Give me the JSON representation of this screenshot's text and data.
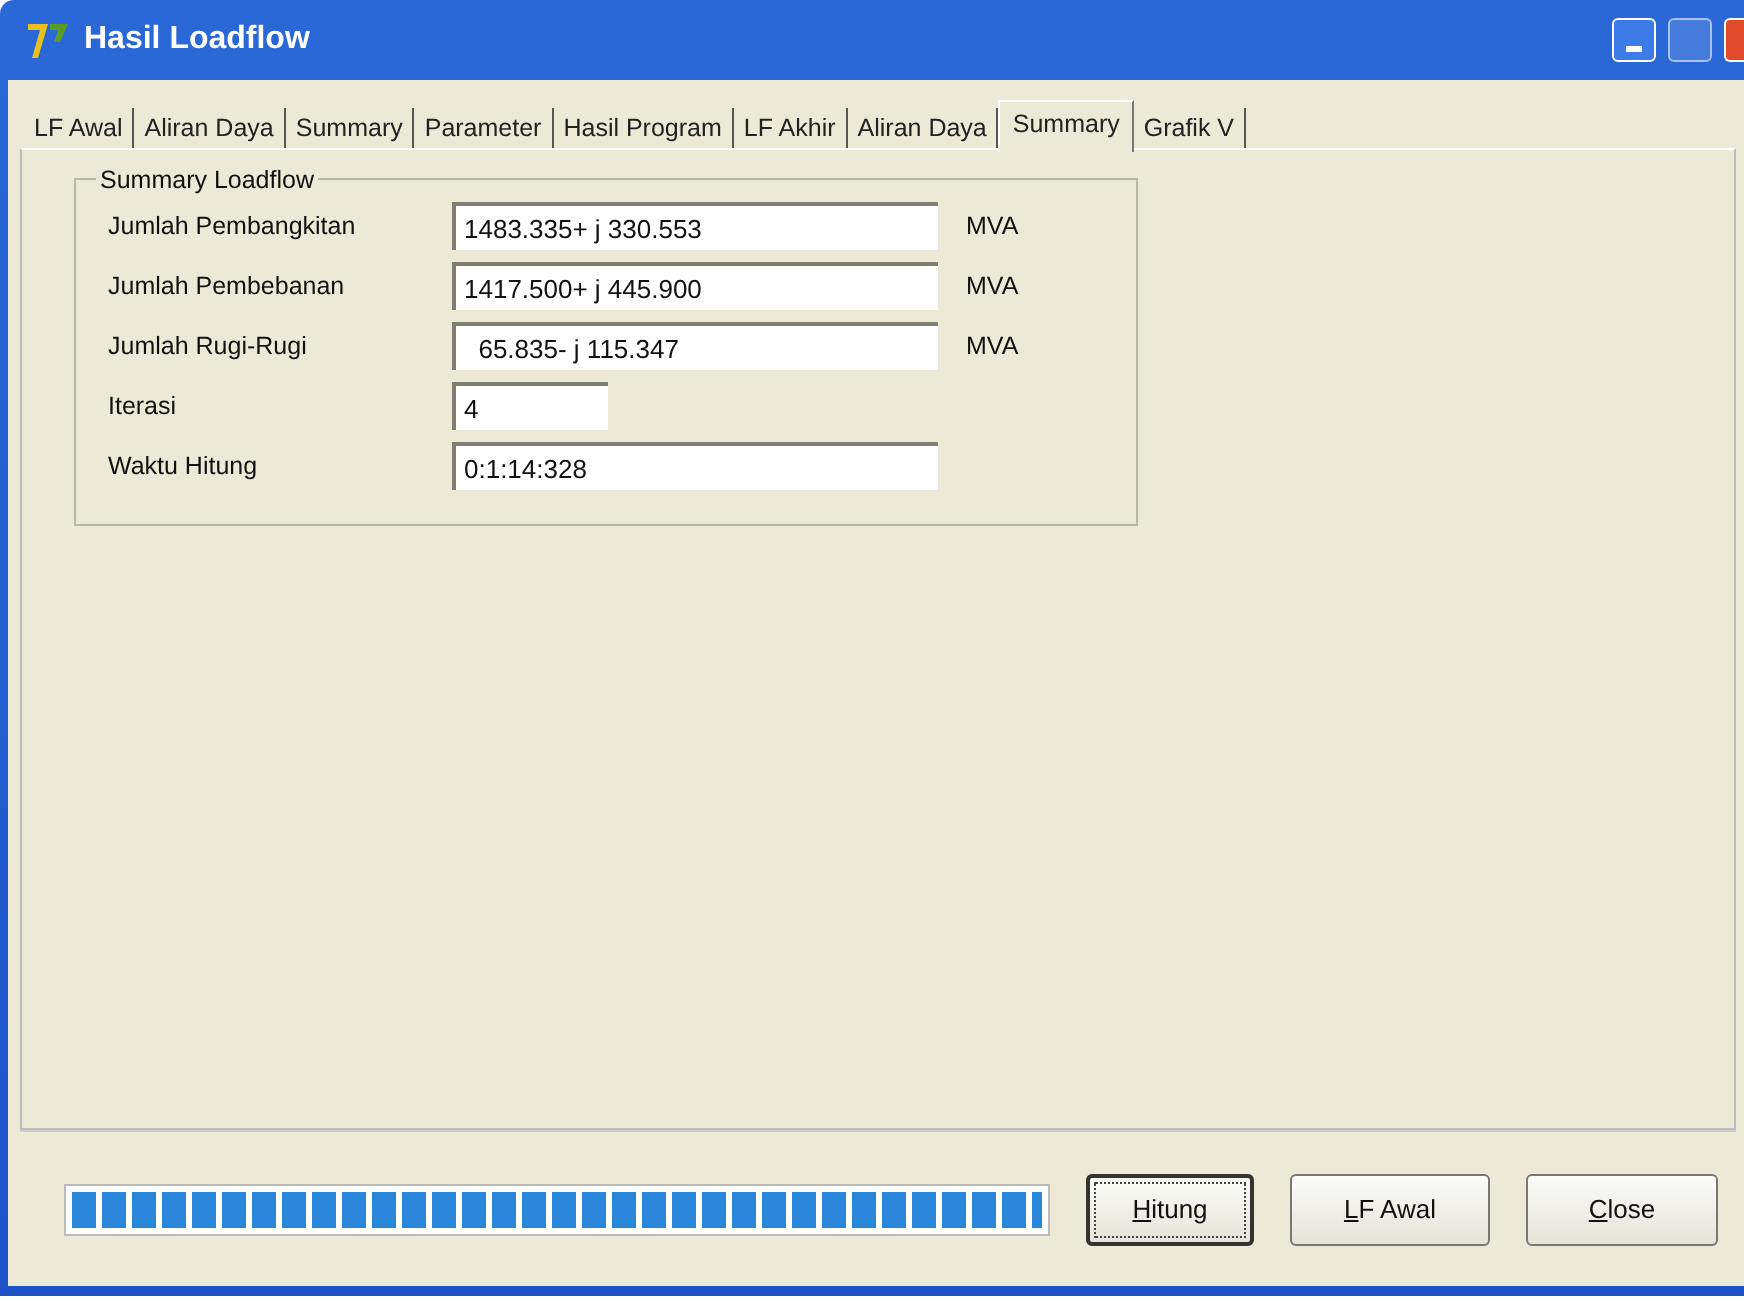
{
  "window": {
    "title": "Hasil Loadflow"
  },
  "tabs": [
    {
      "label": "LF Awal",
      "selected": false
    },
    {
      "label": "Aliran Daya",
      "selected": false
    },
    {
      "label": "Summary",
      "selected": false
    },
    {
      "label": "Parameter",
      "selected": false
    },
    {
      "label": "Hasil Program",
      "selected": false
    },
    {
      "label": "LF Akhir",
      "selected": false
    },
    {
      "label": "Aliran Daya",
      "selected": false
    },
    {
      "label": "Summary",
      "selected": true
    },
    {
      "label": "Grafik V",
      "selected": false
    }
  ],
  "group": {
    "title": "Summary Loadflow",
    "fields": [
      {
        "label": "Jumlah Pembangkitan",
        "value": "1483.335+ j 330.553",
        "unit": "MVA",
        "kind": "wide"
      },
      {
        "label": "Jumlah Pembebanan",
        "value": "1417.500+ j 445.900",
        "unit": "MVA",
        "kind": "wide"
      },
      {
        "label": "Jumlah Rugi-Rugi",
        "value": "  65.835- j 115.347",
        "unit": "MVA",
        "kind": "wide"
      },
      {
        "label": "Iterasi",
        "value": "4",
        "kind": "narrow"
      },
      {
        "label": "Waktu Hitung",
        "value": "0:1:14:328",
        "kind": "wide"
      }
    ]
  },
  "progress": {
    "level": 1
  },
  "buttons": [
    {
      "label": "Hitung",
      "mnemonic": true,
      "focused": true
    },
    {
      "label": "LF Awal",
      "mnemonic": true,
      "focused": false
    },
    {
      "label": "Close",
      "mnemonic": true,
      "focused": false
    }
  ]
}
